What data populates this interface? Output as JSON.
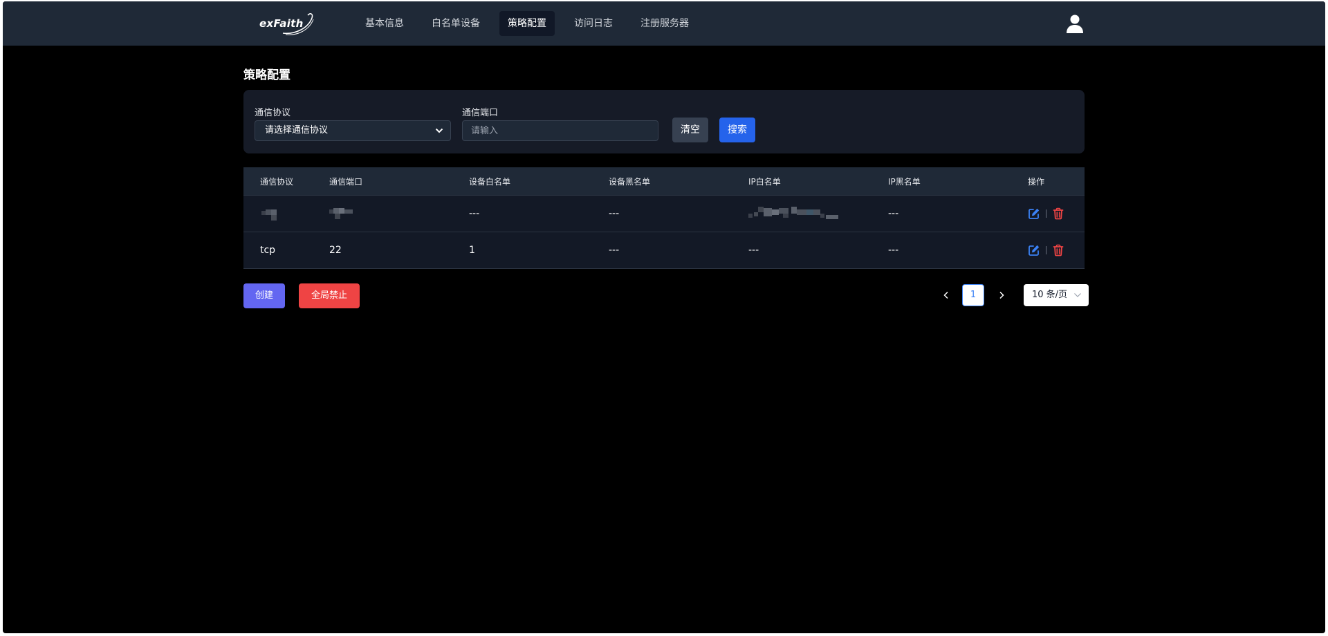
{
  "brand": {
    "name": "exFaith"
  },
  "nav": {
    "items": [
      {
        "label": "基本信息",
        "active": false
      },
      {
        "label": "白名单设备",
        "active": false
      },
      {
        "label": "策略配置",
        "active": true
      },
      {
        "label": "访问日志",
        "active": false
      },
      {
        "label": "注册服务器",
        "active": false
      }
    ],
    "user_icon": "user-icon"
  },
  "page": {
    "title": "策略配置"
  },
  "filter": {
    "protocol_label": "通信协议",
    "protocol_value": "请选择通信协议",
    "port_label": "通信端口",
    "port_placeholder": "请输入",
    "port_value": "",
    "clear_label": "清空",
    "search_label": "搜索"
  },
  "table": {
    "columns": [
      "通信协议",
      "通信端口",
      "设备白名单",
      "设备黑名单",
      "IP白名单",
      "IP黑名单",
      "操作"
    ],
    "rows": [
      {
        "protocol": "",
        "port": "",
        "device_whitelist": "---",
        "device_blacklist": "---",
        "ip_whitelist": "",
        "ip_blacklist": "---",
        "redacted": true
      },
      {
        "protocol": "tcp",
        "port": "22",
        "device_whitelist": "1",
        "device_blacklist": "---",
        "ip_whitelist": "---",
        "ip_blacklist": "---",
        "redacted": false
      }
    ],
    "action_icons": [
      "edit-icon",
      "delete-icon"
    ]
  },
  "actions": {
    "create_label": "创建",
    "global_ban_label": "全局禁止"
  },
  "pagination": {
    "current_page": "1",
    "page_size_label": "10 条/页"
  },
  "colors": {
    "nav_bg": "#1f2937",
    "panel_bg": "#161b27",
    "primary": "#2563eb",
    "create": "#6366f1",
    "danger": "#ef4444"
  }
}
